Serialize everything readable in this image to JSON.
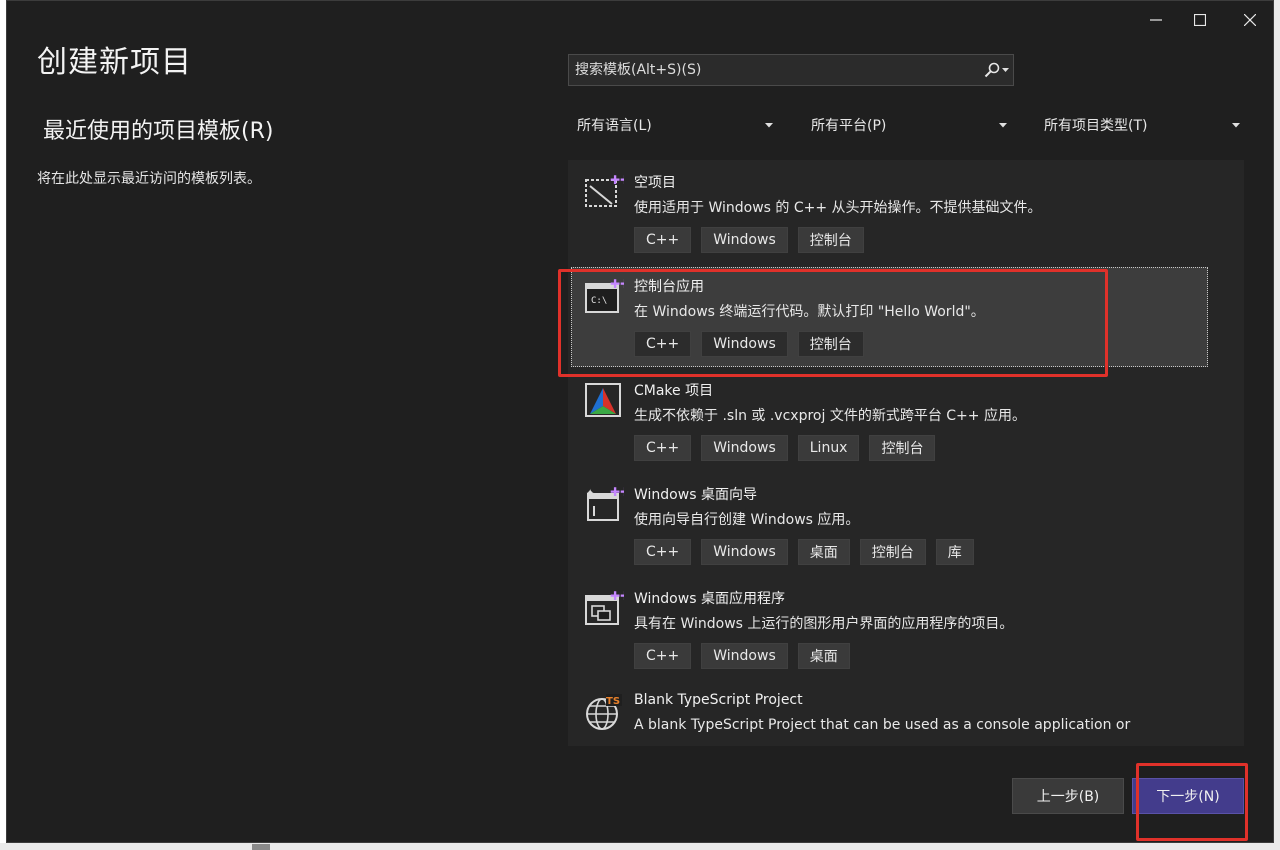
{
  "window": {
    "title": "创建新项目",
    "controls": {
      "minimize": "minimize-icon",
      "maximize": "maximize-icon",
      "close": "close-icon"
    }
  },
  "recent": {
    "heading": "最近使用的项目模板(R)",
    "empty_text": "将在此处显示最近访问的模板列表。"
  },
  "search": {
    "placeholder": "搜索模板(Alt+S)(S)"
  },
  "filters": [
    {
      "label": "所有语言(L)"
    },
    {
      "label": "所有平台(P)"
    },
    {
      "label": "所有项目类型(T)"
    }
  ],
  "templates": [
    {
      "name": "空项目",
      "description": "使用适用于 Windows 的 C++ 从头开始操作。不提供基础文件。",
      "tags": [
        "C++",
        "Windows",
        "控制台"
      ],
      "icon": "empty-project-icon"
    },
    {
      "name": "控制台应用",
      "description": "在 Windows 终端运行代码。默认打印 \"Hello World\"。",
      "tags": [
        "C++",
        "Windows",
        "控制台"
      ],
      "icon": "console-app-icon",
      "selected": true
    },
    {
      "name": "CMake 项目",
      "description": "生成不依赖于 .sln 或 .vcxproj 文件的新式跨平台 C++ 应用。",
      "tags": [
        "C++",
        "Windows",
        "Linux",
        "控制台"
      ],
      "icon": "cmake-icon"
    },
    {
      "name": "Windows 桌面向导",
      "description": "使用向导自行创建 Windows 应用。",
      "tags": [
        "C++",
        "Windows",
        "桌面",
        "控制台",
        "库"
      ],
      "icon": "desktop-wizard-icon"
    },
    {
      "name": "Windows 桌面应用程序",
      "description": "具有在 Windows 上运行的图形用户界面的应用程序的项目。",
      "tags": [
        "C++",
        "Windows",
        "桌面"
      ],
      "icon": "desktop-app-icon"
    },
    {
      "name": "Blank TypeScript Project",
      "description": "A blank TypeScript Project that can be used as a console application or",
      "tags": [],
      "icon": "typescript-globe-icon"
    }
  ],
  "buttons": {
    "back": "上一步(B)",
    "next": "下一步(N)"
  },
  "colors": {
    "accent": "#433c8c",
    "highlight": "#e0312a",
    "background": "#1f1f1f",
    "list_bg": "#262626"
  }
}
